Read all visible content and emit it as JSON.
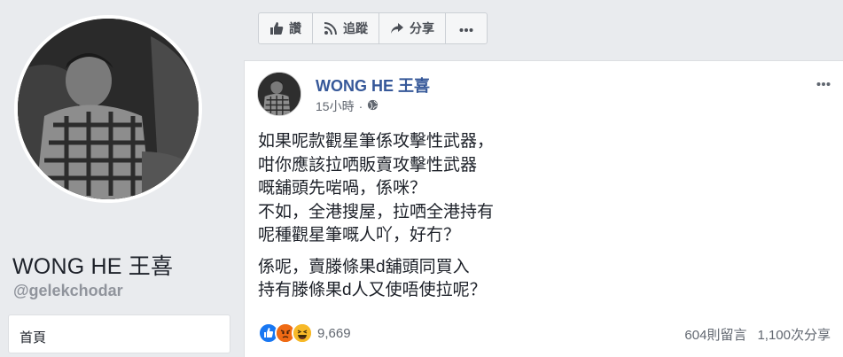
{
  "profile": {
    "name": "WONG HE 王喜",
    "handle": "@gelekchodar",
    "nav_items": [
      {
        "label": "首頁"
      }
    ]
  },
  "actions": [
    {
      "label": "讚",
      "icon": "thumbs-up-icon"
    },
    {
      "label": "追蹤",
      "icon": "rss-icon"
    },
    {
      "label": "分享",
      "icon": "share-arrow-icon"
    },
    {
      "label": "",
      "icon": "more-dots-icon"
    }
  ],
  "post": {
    "author": "WONG HE 王喜",
    "time": "15小時",
    "separator": "·",
    "privacy_icon": "globe-icon",
    "paragraphs": [
      [
        "如果呢款觀星筆係攻擊性武器，",
        "咁你應該拉哂販賣攻擊性武器",
        "嘅舖頭先啱喎，係咪？",
        "不如，全港搜屋，拉哂全港持有",
        "呢種觀星筆嘅人吖，好冇？"
      ],
      [
        "係呢，賣滕條果d舖頭同買入",
        "持有滕條果d人又使唔使拉呢？"
      ]
    ],
    "reactions": {
      "types": [
        "like-reaction-icon",
        "angry-reaction-icon",
        "haha-reaction-icon"
      ],
      "count": "9,669"
    },
    "comments": "604則留言",
    "shares": "1,100次分享"
  },
  "colors": {
    "link": "#365899",
    "background": "#e9ebee",
    "muted": "#616770"
  }
}
